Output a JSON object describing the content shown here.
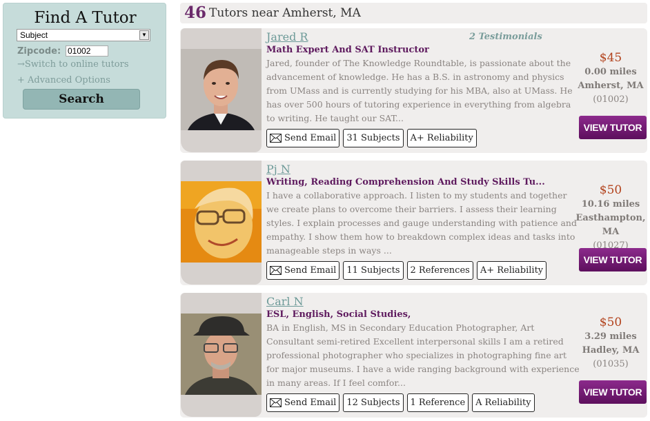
{
  "search": {
    "title": "Find A Tutor",
    "subject_value": "Subject",
    "zipcode_label": "Zipcode:",
    "zipcode_value": "01002",
    "switch_link": "→Switch to online tutors",
    "advanced_link": "+ Advanced Options",
    "search_button": "Search"
  },
  "results": {
    "count": "46",
    "text": "Tutors near Amherst, MA"
  },
  "tutors": [
    {
      "name": "Jared R",
      "testimonials": "2 Testimonials",
      "headline": "Math Expert And SAT Instructor",
      "bio": "Jared, founder of The Knowledge Roundtable, is passionate about the advancement of knowledge. He has a B.S. in astronomy and physics from UMass and is currently studying for his MBA, also at UMass. He has over 500 hours of tutoring experience in everything from algebra to writing. He taught our SAT...",
      "badges": [
        "Send Email",
        "31 Subjects",
        "A+ Reliability"
      ],
      "price": "$45",
      "distance": "0.00 miles",
      "location": "Amherst, MA",
      "zipcode": "(01002)",
      "view_button": "VIEW TUTOR"
    },
    {
      "name": "Pj N",
      "testimonials": "",
      "headline": "Writing, Reading Comprehension And Study Skills Tu...",
      "bio": "I have a collaborative approach. I listen to my students and together we create plans to overcome their barriers. I assess their learning styles. I explain processes and gauge understanding with patience and empathy. I show them how to breakdown complex ideas and tasks into manageable steps in ways ...",
      "badges": [
        "Send Email",
        "11 Subjects",
        "2 References",
        "A+ Reliability"
      ],
      "price": "$50",
      "distance": "10.16 miles",
      "location": "Easthampton, MA",
      "zipcode": "(01027)",
      "view_button": "VIEW TUTOR"
    },
    {
      "name": "Carl N",
      "testimonials": "",
      "headline": "ESL, English, Social Studies,",
      "bio": "BA in English, MS in Secondary Education Photographer, Art Consultant semi-retired Excellent interpersonal skills I am a retired professional photographer who specializes in photographing fine art for major museums. I have a wide ranging background with experience in many areas. If I feel comfor...",
      "badges": [
        "Send Email",
        "12 Subjects",
        "1 Reference",
        "A Reliability"
      ],
      "price": "$50",
      "distance": "3.29 miles",
      "location": "Hadley, MA",
      "zipcode": "(01035)",
      "view_button": "VIEW TUTOR"
    }
  ],
  "colors": {
    "panel_bg": "#c6dcda",
    "card_bg": "#f0eeed",
    "accent_purple": "#6b2a6b",
    "price_orange": "#b2421c",
    "link_teal": "#6d9a98"
  },
  "icons": {
    "email": "envelope-icon",
    "dropdown": "chevron-down-icon"
  }
}
